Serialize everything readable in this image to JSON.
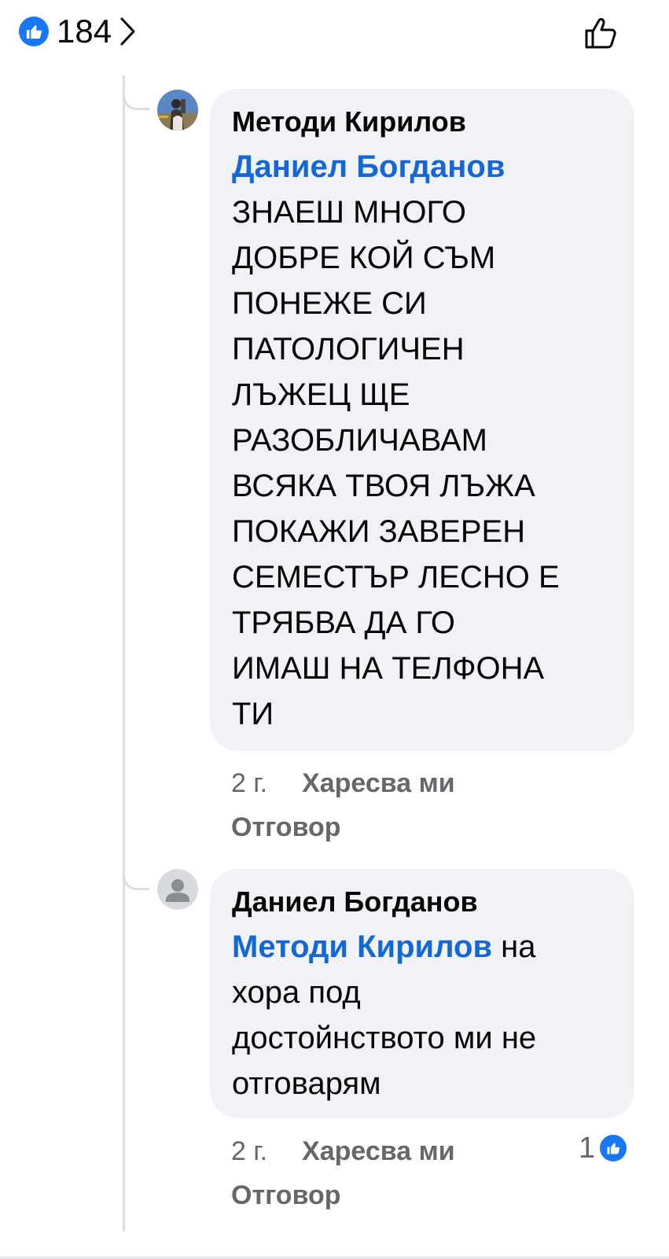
{
  "header": {
    "reaction_count": "184",
    "like_icon": "thumbs-up-icon",
    "chevron_icon": "chevron-right-icon",
    "like_button_icon": "thumbs-up-outline-icon"
  },
  "comments": [
    {
      "author": "Методи Кирилов",
      "avatar": "user-photo-avatar",
      "mention": "Даниел Богданов",
      "mention_trailing": "",
      "body_lines": [
        "ЗНАЕШ МНОГО",
        "ДОБРЕ КОЙ СЪМ",
        "ПОНЕЖЕ СИ",
        "ПАТОЛОГИЧЕН",
        "ЛЪЖЕЦ ЩЕ",
        "РАЗОБЛИЧАВАМ",
        "ВСЯКА ТВОЯ ЛЪЖА",
        "ПОКАЖИ ЗАВЕРЕН",
        "СЕМЕСТЪР ЛЕСНО Е",
        "ТРЯБВА ДА ГО",
        "ИМАШ НА ТЕЛФОНА",
        "ТИ"
      ],
      "time": "2 г.",
      "like_label": "Харесва ми",
      "reply_label": "Отговор"
    },
    {
      "author": "Даниел Богданов",
      "avatar": "default-user-avatar",
      "mention": "Методи Кирилов",
      "mention_trailing": " на",
      "body_lines": [
        "хора под",
        "достойнството ми не",
        "отговарям"
      ],
      "time": "2 г.",
      "like_label": "Харесва ми",
      "reply_label": "Отговор",
      "reaction_count": "1"
    }
  ],
  "colors": {
    "accent_blue": "#1877f2",
    "mention_blue": "#1467d6",
    "bubble_bg": "#f0f2f5",
    "secondary_text": "#65676b"
  }
}
